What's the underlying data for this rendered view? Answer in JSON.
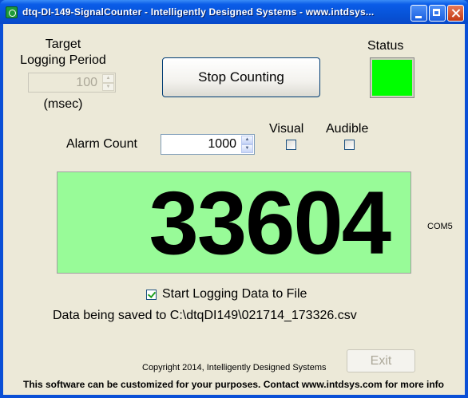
{
  "window": {
    "title": "dtq-DI-149-SignalCounter  -  Intelligently Designed Systems  -  www.intdsys...",
    "minimize_symbol": "",
    "maximize_symbol": "",
    "close_symbol": "",
    "title_bar_color": "#0a5ce8"
  },
  "logging": {
    "title": "Target\nLogging Period",
    "value": "100",
    "unit": "(msec)",
    "enabled": false
  },
  "stop_button": {
    "label": "Stop Counting"
  },
  "status": {
    "label": "Status",
    "color": "#00ff00"
  },
  "alarm": {
    "label": "Alarm Count",
    "value": "1000",
    "visual_label": "Visual",
    "audible_label": "Audible",
    "visual_checked": false,
    "audible_checked": false
  },
  "counter": {
    "value": "33604",
    "background": "#98fb98",
    "port": "COM5"
  },
  "file_logging": {
    "checkbox_label": "Start Logging Data to File",
    "checked": true,
    "saved_text": "Data being saved to C:\\dtqDI149\\021714_173326.csv"
  },
  "exit_button": {
    "label": "Exit",
    "enabled": false
  },
  "copyright": "Copyright 2014, Intelligently Designed Systems",
  "footer": "This software can be customized for your purposes.   Contact www.intdsys.com for more info"
}
